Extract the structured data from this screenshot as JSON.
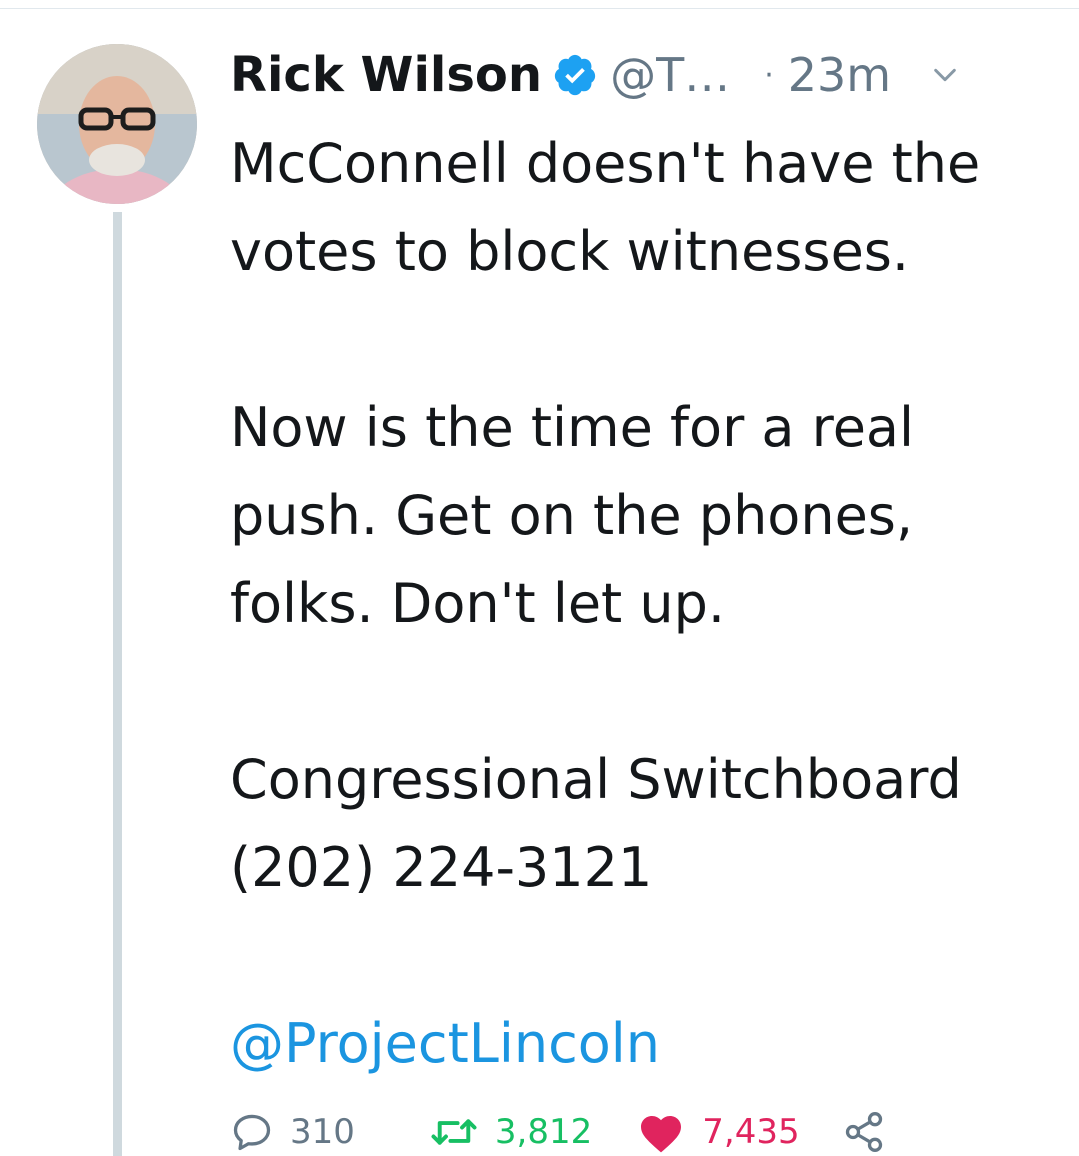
{
  "tweet": {
    "author": {
      "display_name": "Rick Wilson",
      "handle": "@T…",
      "verified": true
    },
    "separator": "·",
    "time": "23m",
    "text": "McConnell doesn't have the\nvotes to block witnesses.\n\nNow is the time for a real\npush. Get on the phones,\nfolks. Don't let up.\n\nCongressional Switchboard\n(202) 224-3121",
    "mention": "@ProjectLincoln",
    "stats": {
      "replies": "310",
      "retweets": "3,812",
      "likes": "7,435"
    }
  },
  "icons": {
    "verified": "verified-badge-icon",
    "caret": "chevron-down-icon",
    "reply": "reply-icon",
    "retweet": "retweet-icon",
    "like": "heart-icon",
    "share": "share-icon"
  },
  "colors": {
    "text": "#14171a",
    "secondary": "#657786",
    "link": "#1b95e0",
    "retweet": "#17bf63",
    "like": "#e0245e",
    "thread_line": "#cfd9de"
  }
}
